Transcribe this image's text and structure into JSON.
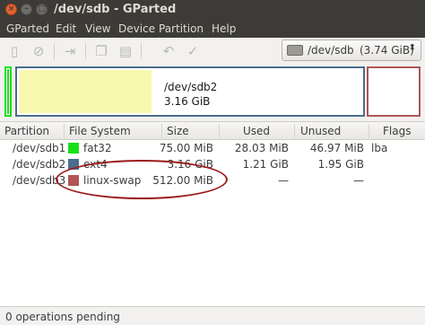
{
  "window": {
    "title": "/dev/sdb - GParted"
  },
  "menu": [
    "GParted",
    "Edit",
    "View",
    "Device",
    "Partition",
    "Help"
  ],
  "toolbar": {
    "buttons": [
      "new-icon",
      "delete-icon",
      "resize-move-icon",
      "copy-icon",
      "paste-icon",
      "undo-icon",
      "apply-icon"
    ],
    "device_name": "/dev/sdb",
    "device_size": "(3.74 GiB)"
  },
  "visual": {
    "partition_name": "/dev/sdb2",
    "partition_size": "3.16 GiB"
  },
  "table": {
    "headers": [
      "Partition",
      "File System",
      "Size",
      "Used",
      "Unused",
      "Flags"
    ],
    "rows": [
      {
        "partition": "/dev/sdb1",
        "fs": "fat32",
        "fs_color": "#18e018",
        "size": "75.00 MiB",
        "used": "28.03 MiB",
        "unused": "46.97 MiB",
        "flags": "lba"
      },
      {
        "partition": "/dev/sdb2",
        "fs": "ext4",
        "fs_color": "#4a6d8c",
        "size": "3.16 GiB",
        "used": "1.21 GiB",
        "unused": "1.95 GiB",
        "flags": ""
      },
      {
        "partition": "/dev/sdb3",
        "fs": "linux-swap",
        "fs_color": "#b05555",
        "size": "512.00 MiB",
        "used": "—",
        "unused": "—",
        "flags": ""
      }
    ]
  },
  "status": {
    "text": "0 operations pending"
  },
  "colors": {
    "fat32": "#18e018",
    "ext4": "#4a6d8c",
    "swap": "#b05555",
    "annotation": "#9c1c1c"
  }
}
